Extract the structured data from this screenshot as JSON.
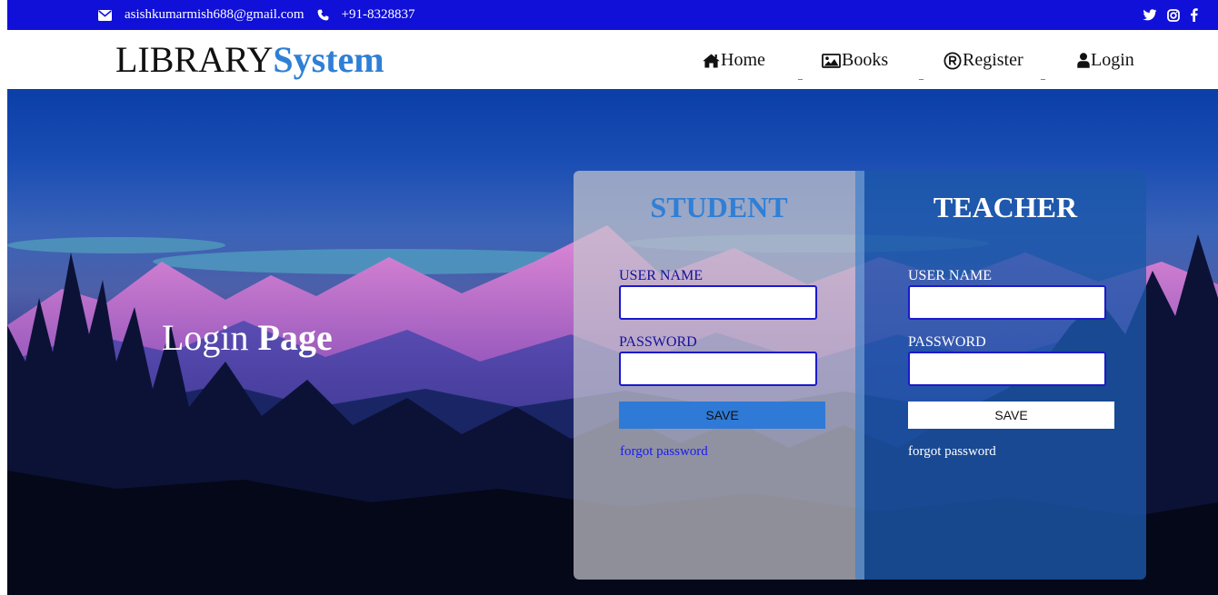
{
  "topbar": {
    "email": "asishkumarmish688@gmail.com",
    "phone": "+91-8328837",
    "social_icons": [
      "twitter-icon",
      "instagram-icon",
      "facebook-icon"
    ],
    "background": "#1110d8"
  },
  "brand": {
    "part1": "LIBRARY",
    "part2": "System",
    "accent": "#2f7fd6"
  },
  "nav": {
    "items": [
      {
        "label": "Home",
        "icon": "home-icon"
      },
      {
        "label": "Books",
        "icon": "image-icon"
      },
      {
        "label": "Register",
        "icon": "registered-icon"
      },
      {
        "label": "Login",
        "icon": "user-icon"
      }
    ],
    "separator": "_"
  },
  "hero": {
    "title_part1": "Login ",
    "title_part2": "Page"
  },
  "student": {
    "heading": "STUDENT",
    "username_label": "USER NAME",
    "username_value": "",
    "password_label": "PASSWORD",
    "password_value": "",
    "save_label": "SAVE",
    "forgot_label": "forgot password"
  },
  "teacher": {
    "heading": "TEACHER",
    "username_label": "USER NAME",
    "username_value": "",
    "password_label": "PASSWORD",
    "password_value": "",
    "save_label": "SAVE",
    "forgot_label": "forgot password"
  }
}
